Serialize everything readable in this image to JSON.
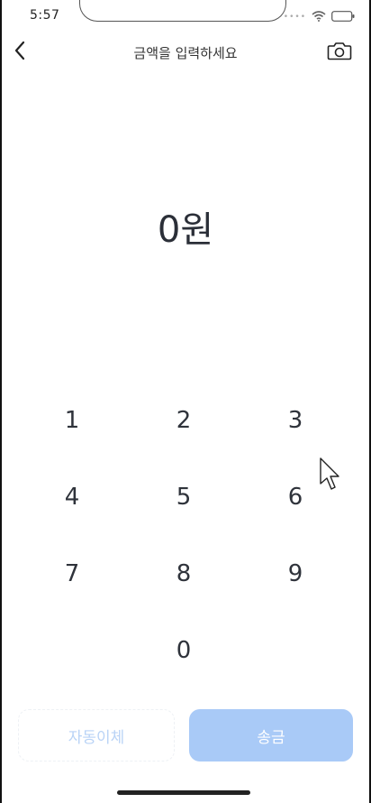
{
  "status_bar": {
    "time": "5:57",
    "icons": [
      "signal-icon",
      "wifi-icon",
      "battery-icon"
    ]
  },
  "header": {
    "title": "금액을 입력하세요",
    "back_icon": "chevron-left-icon",
    "camera_icon": "camera-icon"
  },
  "amount": {
    "value": "0",
    "unit": "원"
  },
  "keypad": {
    "keys": [
      "1",
      "2",
      "3",
      "4",
      "5",
      "6",
      "7",
      "8",
      "9",
      "0"
    ]
  },
  "actions": {
    "auto_transfer_label": "자동이체",
    "send_label": "송금"
  },
  "colors": {
    "send_button": "#a9caf7",
    "auto_transfer_text": "#b9d3f6",
    "amount_text": "#2b2f38"
  }
}
